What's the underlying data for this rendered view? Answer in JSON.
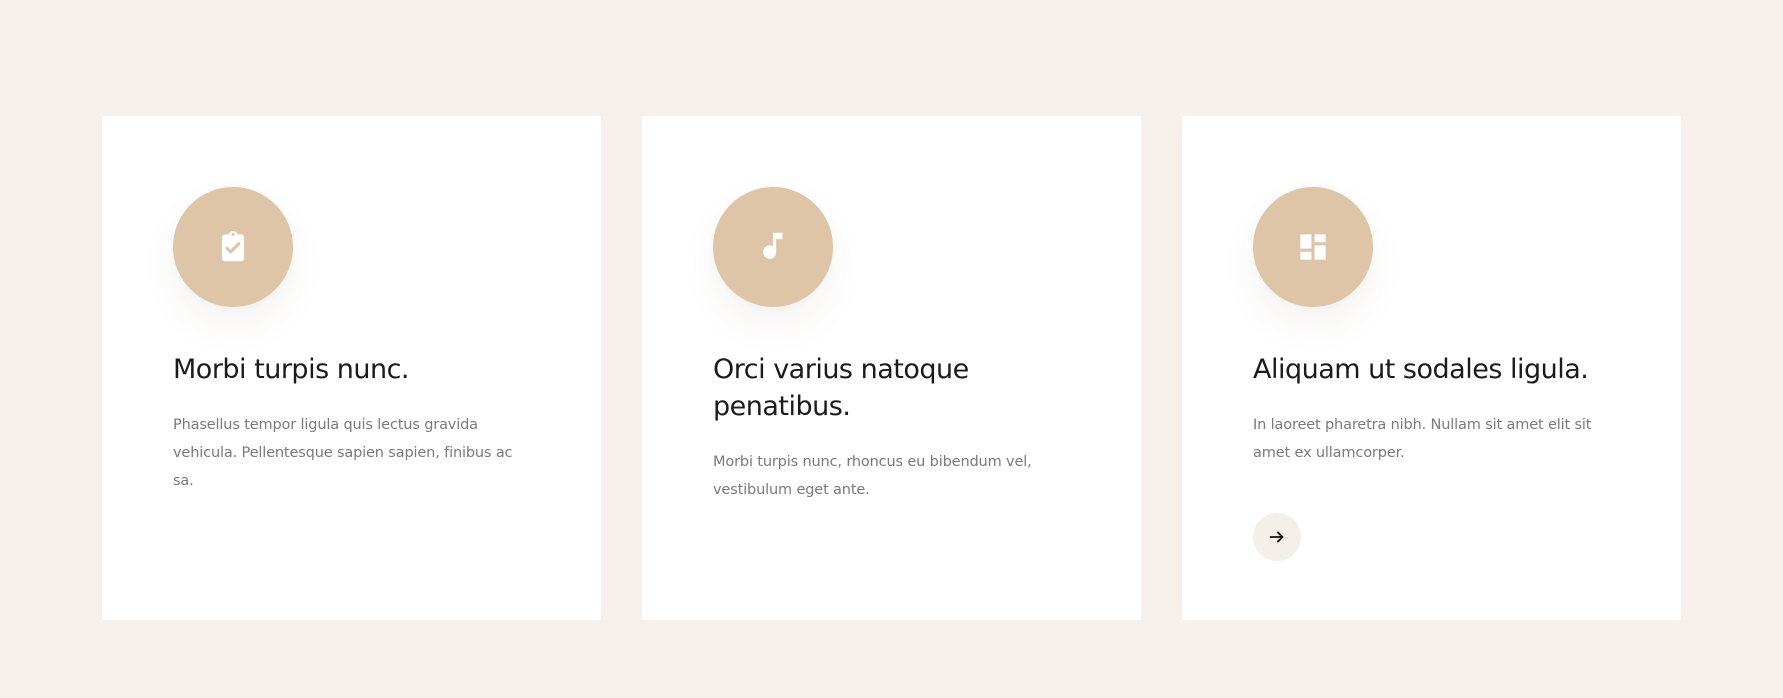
{
  "cards": [
    {
      "icon": "clipboard-check-icon",
      "title": "Morbi turpis nunc.",
      "text": "Phasellus tempor ligula quis lectus gravida vehicula. Pellentesque sapien sapien, finibus ac sa."
    },
    {
      "icon": "music-note-icon",
      "title": "Orci varius natoque penatibus.",
      "text": "Morbi turpis nunc, rhoncus eu bibendum vel, vestibulum eget ante."
    },
    {
      "icon": "dashboard-layout-icon",
      "title": "Aliquam ut sodales ligula.",
      "text": "In laoreet pharetra nibh. Nullam sit amet elit sit amet ex ullamcorper.",
      "action_icon": "arrow-right-icon"
    }
  ],
  "colors": {
    "background": "#f5f0ec",
    "card_background": "#ffffff",
    "icon_circle": "#dfc5a7",
    "title_text": "#1b1b1b",
    "body_text": "#7a7a7a",
    "arrow_button": "#f5efea"
  }
}
